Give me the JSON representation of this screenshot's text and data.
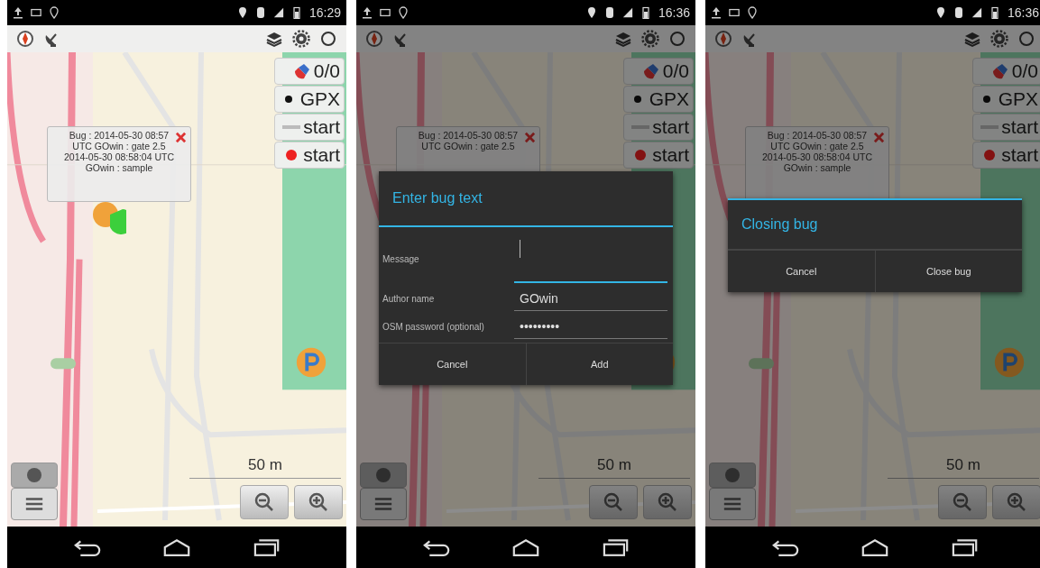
{
  "screens": [
    {
      "status_bar": {
        "time": "16:29"
      },
      "side_buttons": [
        {
          "kind": "satellite",
          "label": "0/0"
        },
        {
          "kind": "dot",
          "label": "GPX"
        },
        {
          "kind": "line",
          "label": "start"
        },
        {
          "kind": "record",
          "label": "start"
        }
      ],
      "bug_popup": {
        "lines": [
          "Bug : 2014-05-30 08:57",
          "UTC GOwin : gate 2.5",
          "2014-05-30 08:58:04 UTC",
          "GOwin : sample"
        ]
      },
      "scale": "50 m"
    },
    {
      "status_bar": {
        "time": "16:36"
      },
      "side_buttons": [
        {
          "kind": "satellite",
          "label": "0/0"
        },
        {
          "kind": "dot",
          "label": "GPX"
        },
        {
          "kind": "line",
          "label": "start"
        },
        {
          "kind": "record",
          "label": "start"
        }
      ],
      "bug_popup": {
        "lines": [
          "Bug : 2014-05-30 08:57",
          "UTC GOwin : gate 2.5"
        ]
      },
      "scale": "50 m",
      "dialog": {
        "kind": "form",
        "title": "Enter bug text",
        "fields": [
          {
            "label": "Message",
            "focused": true
          },
          {
            "label": "Author name",
            "value": "GOwin",
            "focused": false
          },
          {
            "label": "OSM password (optional)",
            "value": "•••••••••",
            "focused": false
          }
        ],
        "buttons": [
          "Cancel",
          "Add"
        ]
      }
    },
    {
      "status_bar": {
        "time": "16:36"
      },
      "side_buttons": [
        {
          "kind": "satellite",
          "label": "0/0"
        },
        {
          "kind": "dot",
          "label": "GPX"
        },
        {
          "kind": "line",
          "label": "start"
        },
        {
          "kind": "record",
          "label": "start"
        }
      ],
      "bug_popup": {
        "lines": [
          "Bug : 2014-05-30 08:57",
          "UTC GOwin : gate 2.5",
          "2014-05-30 08:58:04 UTC",
          "GOwin : sample"
        ]
      },
      "scale": "50 m",
      "dialog": {
        "kind": "confirm",
        "title": "Closing bug",
        "buttons": [
          "Cancel",
          "Close bug"
        ]
      }
    }
  ]
}
